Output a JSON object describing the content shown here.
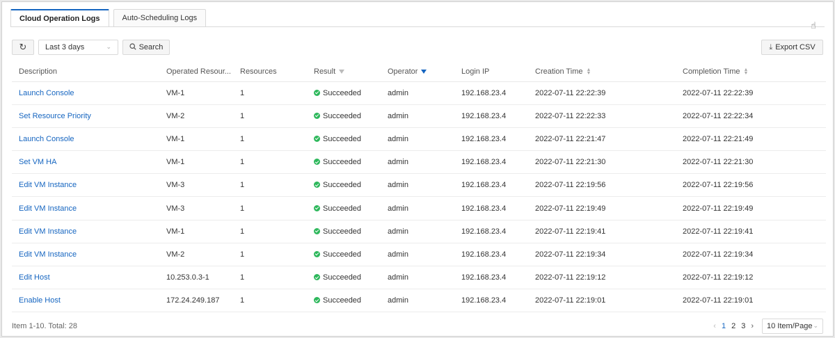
{
  "tabs": [
    {
      "label": "Cloud Operation Logs"
    },
    {
      "label": "Auto-Scheduling Logs"
    }
  ],
  "toolbar": {
    "range_value": "Last 3 days",
    "search_label": "Search",
    "export_label": "Export CSV"
  },
  "columns": [
    "Description",
    "Operated Resour...",
    "Resources",
    "Result",
    "Operator",
    "Login IP",
    "Creation Time",
    "Completion Time"
  ],
  "rows": [
    {
      "description": "Launch Console",
      "resource": "VM-1",
      "count": "1",
      "result": "Succeeded",
      "operator": "admin",
      "ip": "192.168.23.4",
      "created": "2022-07-11 22:22:39",
      "completed": "2022-07-11 22:22:39"
    },
    {
      "description": "Set Resource Priority",
      "resource": "VM-2",
      "count": "1",
      "result": "Succeeded",
      "operator": "admin",
      "ip": "192.168.23.4",
      "created": "2022-07-11 22:22:33",
      "completed": "2022-07-11 22:22:34"
    },
    {
      "description": "Launch Console",
      "resource": "VM-1",
      "count": "1",
      "result": "Succeeded",
      "operator": "admin",
      "ip": "192.168.23.4",
      "created": "2022-07-11 22:21:47",
      "completed": "2022-07-11 22:21:49"
    },
    {
      "description": "Set VM HA",
      "resource": "VM-1",
      "count": "1",
      "result": "Succeeded",
      "operator": "admin",
      "ip": "192.168.23.4",
      "created": "2022-07-11 22:21:30",
      "completed": "2022-07-11 22:21:30"
    },
    {
      "description": "Edit VM Instance",
      "resource": "VM-3",
      "count": "1",
      "result": "Succeeded",
      "operator": "admin",
      "ip": "192.168.23.4",
      "created": "2022-07-11 22:19:56",
      "completed": "2022-07-11 22:19:56"
    },
    {
      "description": "Edit VM Instance",
      "resource": "VM-3",
      "count": "1",
      "result": "Succeeded",
      "operator": "admin",
      "ip": "192.168.23.4",
      "created": "2022-07-11 22:19:49",
      "completed": "2022-07-11 22:19:49"
    },
    {
      "description": "Edit VM Instance",
      "resource": "VM-1",
      "count": "1",
      "result": "Succeeded",
      "operator": "admin",
      "ip": "192.168.23.4",
      "created": "2022-07-11 22:19:41",
      "completed": "2022-07-11 22:19:41"
    },
    {
      "description": "Edit VM Instance",
      "resource": "VM-2",
      "count": "1",
      "result": "Succeeded",
      "operator": "admin",
      "ip": "192.168.23.4",
      "created": "2022-07-11 22:19:34",
      "completed": "2022-07-11 22:19:34"
    },
    {
      "description": "Edit Host",
      "resource": "10.253.0.3-1",
      "count": "1",
      "result": "Succeeded",
      "operator": "admin",
      "ip": "192.168.23.4",
      "created": "2022-07-11 22:19:12",
      "completed": "2022-07-11 22:19:12"
    },
    {
      "description": "Enable Host",
      "resource": "172.24.249.187",
      "count": "1",
      "result": "Succeeded",
      "operator": "admin",
      "ip": "192.168.23.4",
      "created": "2022-07-11 22:19:01",
      "completed": "2022-07-11 22:19:01"
    }
  ],
  "footer": {
    "total_text": "Item 1-10. Total: 28",
    "pages": [
      "1",
      "2",
      "3"
    ],
    "page_size": "10 Item/Page"
  },
  "icons": {
    "refresh": "refresh-icon",
    "search": "search-icon",
    "export": "download-icon",
    "filter": "filter-icon",
    "sort": "sort-icon",
    "success": "check-circle-icon"
  },
  "colors": {
    "accent": "#1565c0",
    "success": "#2eb85c"
  }
}
